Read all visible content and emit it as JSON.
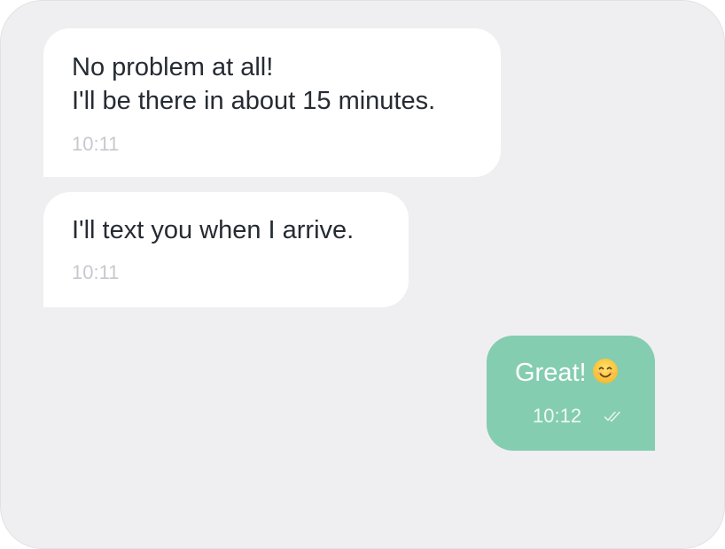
{
  "conversation": {
    "messages": [
      {
        "direction": "incoming",
        "lines": [
          "No problem at all!",
          "I'll be there in about 15 minutes."
        ],
        "time": "10:11"
      },
      {
        "direction": "incoming",
        "lines": [
          "I'll text you when I arrive."
        ],
        "time": "10:11"
      },
      {
        "direction": "outgoing",
        "lines": [
          "Great!"
        ],
        "emoji": "smiling-face-icon",
        "time": "10:12",
        "status_icon": "double-check-icon"
      }
    ]
  },
  "colors": {
    "background": "#efeff1",
    "incoming_bubble": "#ffffff",
    "outgoing_bubble": "#84cdb1",
    "text": "#262b33",
    "timestamp": "#c8c9cf"
  }
}
